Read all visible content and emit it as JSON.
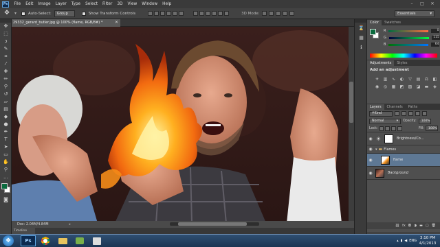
{
  "menu": {
    "logo": "Ps",
    "items": [
      "File",
      "Edit",
      "Image",
      "Layer",
      "Type",
      "Select",
      "Filter",
      "3D",
      "View",
      "Window",
      "Help"
    ]
  },
  "options": {
    "auto_select_label": "Auto-Select:",
    "auto_select_value": "Group",
    "transform_label": "Show Transform Controls",
    "mode_label": "3D Mode:",
    "workspace": "Essentials"
  },
  "document": {
    "tab_title": "29332_gerard_butler.jpg @ 100% (flame, RGB/8#) *",
    "doc_size": "Doc: 2.04M/4.84M"
  },
  "colors": {
    "accent": "#2e7bbf",
    "fg_swatch": "#0a6b3e",
    "bg_swatch": "#ffffff"
  },
  "color_panel": {
    "tabs": [
      "Color",
      "Swatches"
    ],
    "channels": [
      {
        "label": "R",
        "value": "0"
      },
      {
        "label": "G",
        "value": "115"
      },
      {
        "label": "B",
        "value": "64"
      }
    ]
  },
  "adjustments": {
    "tabs": [
      "Adjustments",
      "Styles"
    ],
    "title": "Add an adjustment"
  },
  "layers_panel": {
    "tabs": [
      "Layers",
      "Channels",
      "Paths"
    ],
    "kind_label": "Kind",
    "blend_mode": "Normal",
    "opacity_label": "Opacity:",
    "opacity_value": "100%",
    "lock_label": "Lock:",
    "fill_label": "Fill:",
    "fill_value": "100%",
    "layers": [
      {
        "name": "Brightness/Co...",
        "type": "adjustment"
      },
      {
        "name": "Flames",
        "type": "group"
      },
      {
        "name": "flame",
        "type": "layer",
        "selected": true
      },
      {
        "name": "Background",
        "type": "background"
      }
    ]
  },
  "taskbar": {
    "lang": "ENG",
    "time": "3:10 PM",
    "date": "4/1/2013"
  }
}
